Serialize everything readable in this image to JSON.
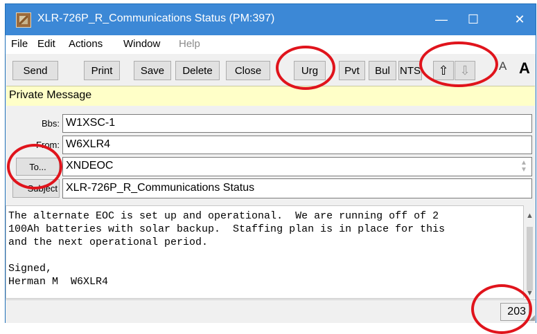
{
  "window": {
    "title": "XLR-726P_R_Communications Status  (PM:397)",
    "minimize": "—",
    "maximize": "☐",
    "close": "✕"
  },
  "menu": [
    "File",
    "Edit",
    "Actions",
    "Window",
    "Help"
  ],
  "toolbar": {
    "send": "Send",
    "print": "Print",
    "save": "Save",
    "delete": "Delete",
    "close": "Close",
    "urg": "Urg",
    "pvt": "Pvt",
    "bul": "Bul",
    "nts": "NTS",
    "up_arrow": "⇧",
    "down_arrow": "⇩",
    "font_small": "A",
    "font_large": "A"
  },
  "banner": "Private Message",
  "fields": {
    "bbs_label": "Bbs:",
    "bbs_value": "W1XSC-1",
    "from_label": "From:",
    "from_value": "W6XLR4",
    "to_button": "To...",
    "to_value": "XNDEOC",
    "subject_button": "Subject",
    "subject_value": "XLR-726P_R_Communications Status"
  },
  "message_body": "The alternate EOC is set up and operational.  We are running off of 2\n100Ah batteries with solar backup.  Staffing plan is in place for this\nand the next operational period.\n\nSigned,\nHerman M  W6XLR4",
  "status": {
    "char_count": "203"
  },
  "colors": {
    "title_bar": "#3c88d6",
    "banner": "#ffffc8",
    "annotation": "#e0141c"
  },
  "icons": [
    "app-icon",
    "minimize-icon",
    "maximize-icon",
    "close-icon",
    "up-arrow-icon",
    "down-arrow-icon",
    "spin-up-icon",
    "spin-down-icon",
    "scroll-up-icon",
    "scroll-down-icon",
    "resize-grip-icon"
  ]
}
